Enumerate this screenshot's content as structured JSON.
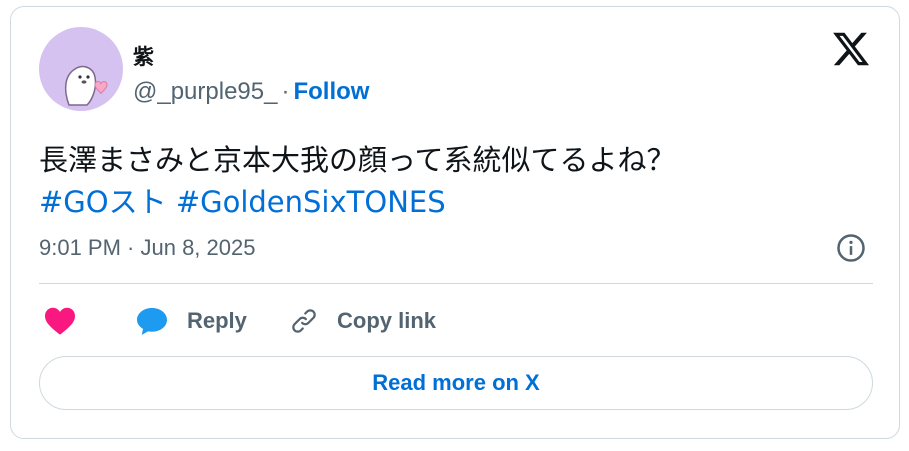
{
  "author": {
    "display_name": "紫",
    "handle": "@_purple95_",
    "separator": "·",
    "follow_label": "Follow"
  },
  "tweet": {
    "text": "長澤まさみと京本大我の顔って系統似てるよね？",
    "hashtags": [
      "#GOスト",
      "#GoldenSixTONES"
    ],
    "timestamp": "9:01 PM · Jun 8, 2025"
  },
  "actions": {
    "like_icon": "heart-icon",
    "reply_label": "Reply",
    "copy_label": "Copy link"
  },
  "read_more_label": "Read more on X",
  "colors": {
    "link": "#006fd6",
    "secondary": "#536471",
    "heart": "#f91880",
    "reply_bubble": "#1d9bf0",
    "border": "#cfd9de",
    "avatar_bg": "#d6c2f0"
  }
}
